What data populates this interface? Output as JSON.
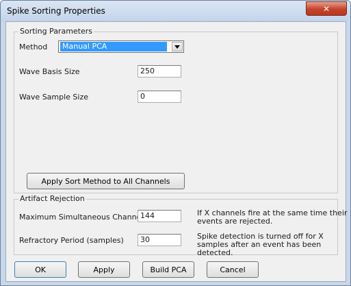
{
  "window": {
    "title": "Spike Sorting Properties",
    "close_glyph": "✕"
  },
  "sorting": {
    "legend": "Sorting Parameters",
    "method_label": "Method",
    "method_value": "Manual PCA",
    "wave_basis_label": "Wave Basis Size",
    "wave_basis_value": "250",
    "wave_sample_label": "Wave Sample Size",
    "wave_sample_value": "0",
    "apply_all_label": "Apply Sort Method to All Channels"
  },
  "artifact": {
    "legend": "Artifact Rejection",
    "max_channels_label": "Maximum Simultaneous Channels",
    "max_channels_value": "144",
    "max_channels_note": "If X channels fire at the same time their events are rejected.",
    "refractory_label": "Refractory Period (samples)",
    "refractory_value": "30",
    "refractory_note": "Spike detection is turned off for X samples after an event has been detected."
  },
  "buttons": {
    "ok": "OK",
    "apply": "Apply",
    "build_pca": "Build PCA",
    "cancel": "Cancel"
  },
  "icons": {
    "close": "close-icon",
    "dropdown": "chevron-down-icon"
  }
}
